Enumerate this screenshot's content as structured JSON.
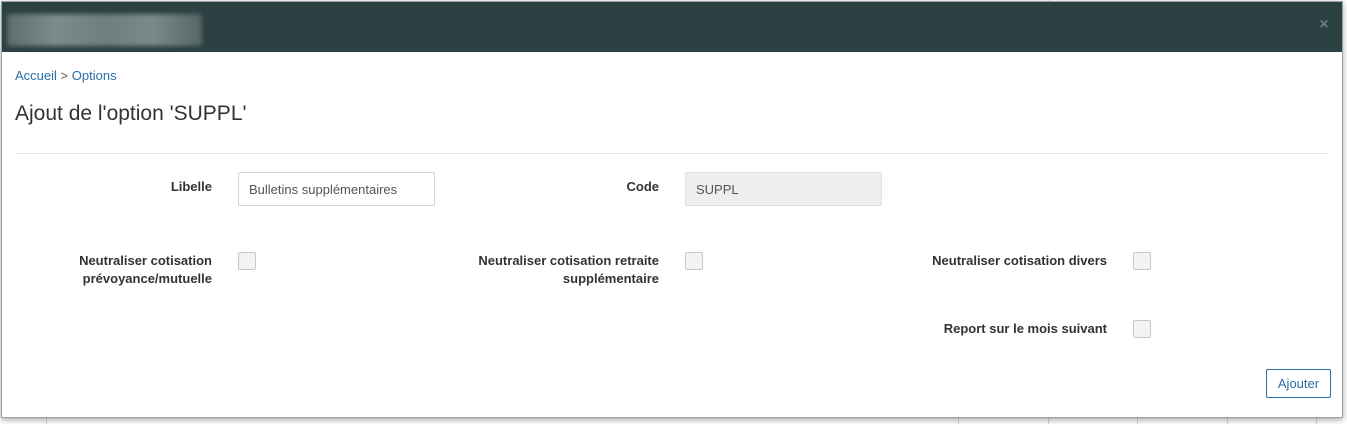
{
  "modal": {
    "header_title": "",
    "close_glyph": "×"
  },
  "breadcrumb": {
    "home": "Accueil",
    "separator": ">",
    "current": "Options"
  },
  "page_title": "Ajout de l'option 'SUPPL'",
  "form": {
    "libelle_label": "Libelle",
    "libelle_value": "Bulletins supplémentaires",
    "code_label": "Code",
    "code_value": "SUPPL",
    "neutraliser_prevoyance_label_line1": "Neutraliser cotisation",
    "neutraliser_prevoyance_label_line2": "prévoyance/mutuelle",
    "neutraliser_retraite_label_line1": "Neutraliser cotisation retraite",
    "neutraliser_retraite_label_line2": "supplémentaire",
    "neutraliser_divers_label": "Neutraliser cotisation divers",
    "report_mois_label": "Report sur le mois suivant",
    "submit_label": "Ajouter"
  },
  "colors": {
    "header_bg": "#2c4142",
    "link": "#2b6ea8",
    "button_border": "#2b6ea8"
  }
}
